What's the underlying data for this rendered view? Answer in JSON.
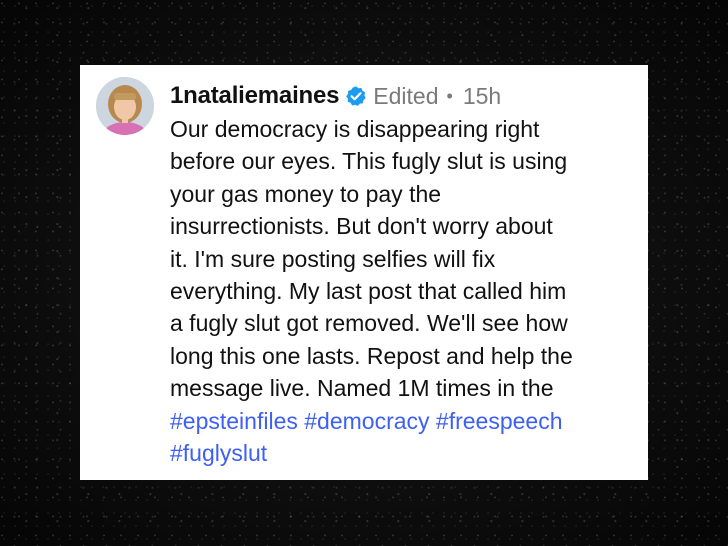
{
  "post": {
    "username": "1nataliemaines",
    "verified_icon": "verified-badge-icon",
    "edited_label": "Edited",
    "separator": "•",
    "timestamp": "15h",
    "lines": [
      "Our democracy is disappearing right",
      "before our eyes. This fugly slut is using",
      "your gas money to pay the",
      "insurrectionists. But don't worry about",
      "it. I'm sure posting selfies will fix",
      "everything. My last post that called him",
      "a fugly slut got removed.  We'll see how",
      "long this one lasts. Repost and help the",
      "message live. Named 1M times in the"
    ],
    "hashtags_line1": [
      "#epsteinfiles",
      "#democracy",
      "#freespeech"
    ],
    "hashtags_line2": [
      "#fuglyslut"
    ]
  },
  "colors": {
    "hashtag": "#3d5ff5",
    "verified_badge": "#1d9bf0",
    "meta_text": "#7a7a7a",
    "background": "#0b0b0b",
    "card": "#ffffff"
  }
}
